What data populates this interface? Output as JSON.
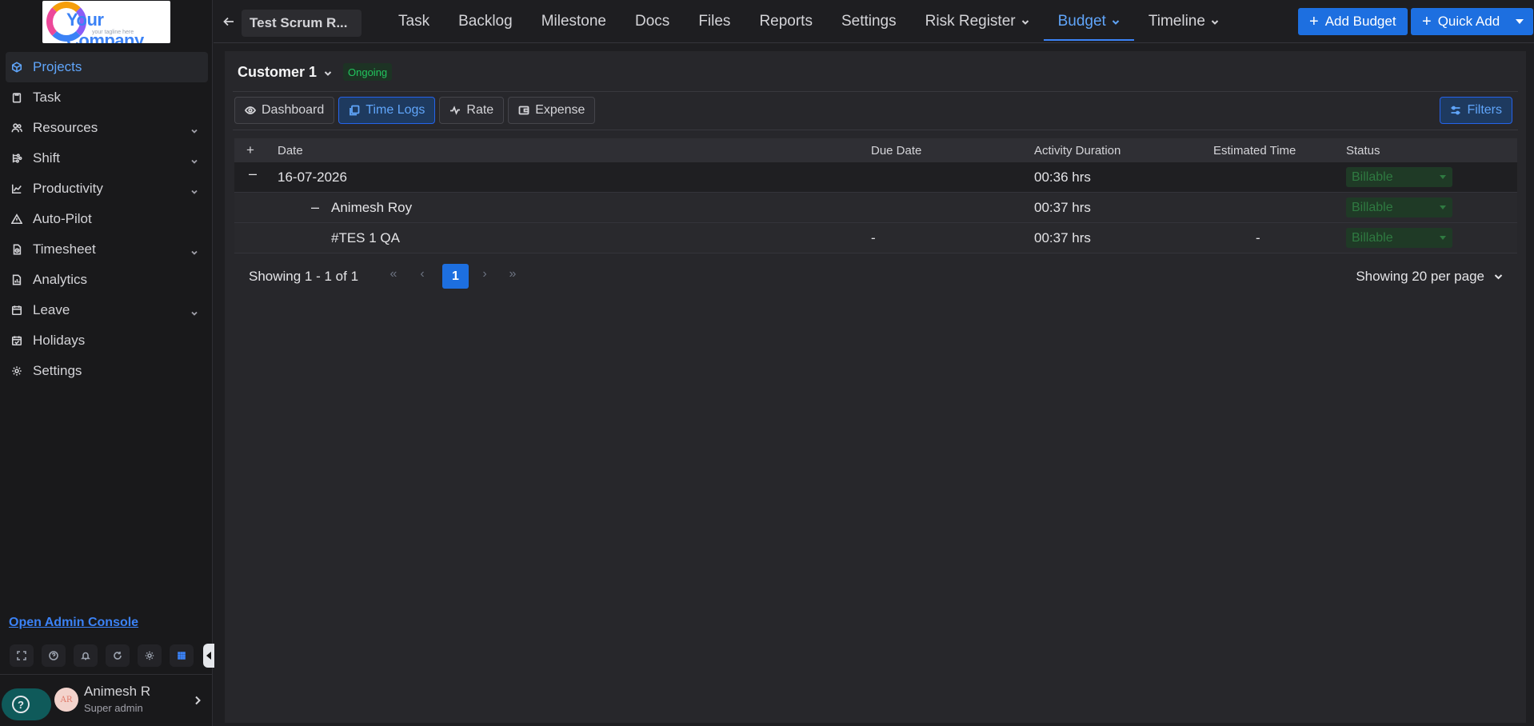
{
  "brand": {
    "logo_text": "Your Company",
    "logo_tagline": "your tagline here"
  },
  "sidebar": {
    "items": [
      {
        "label": "Projects",
        "icon": "cube-icon",
        "active": true
      },
      {
        "label": "Task",
        "icon": "clipboard-icon"
      },
      {
        "label": "Resources",
        "icon": "users-icon",
        "has_children": true
      },
      {
        "label": "Shift",
        "icon": "shift-icon",
        "has_children": true
      },
      {
        "label": "Productivity",
        "icon": "chart-line-icon",
        "has_children": true
      },
      {
        "label": "Auto-Pilot",
        "icon": "warning-triangle-icon"
      },
      {
        "label": "Timesheet",
        "icon": "timesheet-icon",
        "has_children": true
      },
      {
        "label": "Analytics",
        "icon": "analytics-icon"
      },
      {
        "label": "Leave",
        "icon": "calendar-icon",
        "has_children": true
      },
      {
        "label": "Holidays",
        "icon": "calendar-check-icon"
      },
      {
        "label": "Settings",
        "icon": "gear-icon"
      }
    ],
    "admin_link": "Open Admin Console",
    "profile": {
      "initials": "AR",
      "name": "Animesh R",
      "role": "Super admin"
    }
  },
  "topbar": {
    "project_name": "Test Scrum R...",
    "tabs": [
      {
        "label": "Task"
      },
      {
        "label": "Backlog"
      },
      {
        "label": "Milestone"
      },
      {
        "label": "Docs"
      },
      {
        "label": "Files"
      },
      {
        "label": "Reports"
      },
      {
        "label": "Settings"
      },
      {
        "label": "Risk Register",
        "dropdown": true
      },
      {
        "label": "Budget",
        "dropdown": true,
        "active": true
      },
      {
        "label": "Timeline",
        "dropdown": true
      }
    ],
    "add_budget": "Add Budget",
    "quick_add": "Quick Add"
  },
  "budget": {
    "customer": "Customer 1",
    "status_badge": "Ongoing",
    "subtabs": [
      "Dashboard",
      "Time Logs",
      "Rate",
      "Expense"
    ],
    "active_subtab": "Time Logs",
    "filters_label": "Filters",
    "columns": {
      "expand": "+",
      "date": "Date",
      "due_date": "Due Date",
      "activity_duration": "Activity Duration",
      "estimated_time": "Estimated Time",
      "status": "Status"
    },
    "rows": [
      {
        "toggle": "–",
        "label": "16-07-2026",
        "due_date": "",
        "duration": "00:36 hrs",
        "estimated": "",
        "status": "Billable"
      },
      {
        "toggle": "–",
        "label": "Animesh Roy",
        "due_date": "",
        "duration": "00:37 hrs",
        "estimated": "",
        "status": "Billable"
      },
      {
        "toggle": "",
        "label": "#TES 1 QA",
        "due_date": "-",
        "duration": "00:37 hrs",
        "estimated": "-",
        "status": "Billable"
      }
    ],
    "pagination": {
      "summary": "Showing 1 - 1 of 1",
      "first": "«",
      "prev": "‹",
      "current": "1",
      "next": "›",
      "last": "»",
      "per_page": "Showing 20 per page"
    }
  },
  "colors": {
    "accent": "#1d6fe0",
    "active_text": "#60a5fa",
    "ongoing": "#22c55e",
    "billable": "#2f7a41"
  }
}
